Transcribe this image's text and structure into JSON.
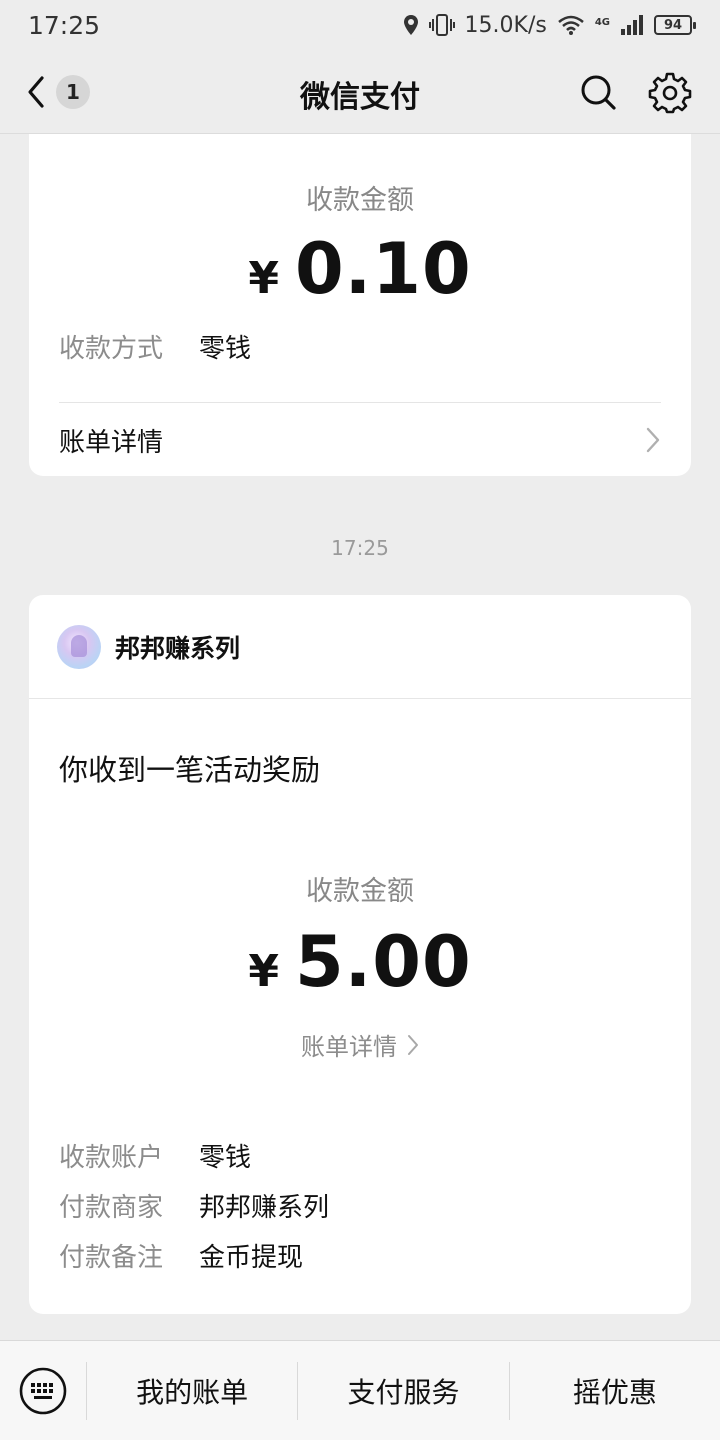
{
  "status_bar": {
    "time": "17:25",
    "network_speed": "15.0K/s",
    "network_type": "4G",
    "battery": "94"
  },
  "nav": {
    "title": "微信支付",
    "unread_count": "1"
  },
  "card1": {
    "amount_label": "收款金额",
    "currency": "¥",
    "amount": "0.10",
    "method_key": "收款方式",
    "method_value": "零钱",
    "bill_detail": "账单详情"
  },
  "timestamp": "17:25",
  "card2": {
    "merchant_name": "邦邦赚系列",
    "event_title": "你收到一笔活动奖励",
    "amount_label": "收款金额",
    "currency": "¥",
    "amount": "5.00",
    "bill_detail": "账单详情",
    "rows": [
      {
        "key": "收款账户",
        "value": "零钱"
      },
      {
        "key": "付款商家",
        "value": "邦邦赚系列"
      },
      {
        "key": "付款备注",
        "value": "金币提现"
      }
    ]
  },
  "bottom_menu": {
    "items": [
      "我的账单",
      "支付服务",
      "摇优惠"
    ]
  },
  "colors": {
    "background": "#ededed",
    "card": "#ffffff",
    "text_primary": "#111111",
    "text_secondary": "#8c8c8c"
  }
}
